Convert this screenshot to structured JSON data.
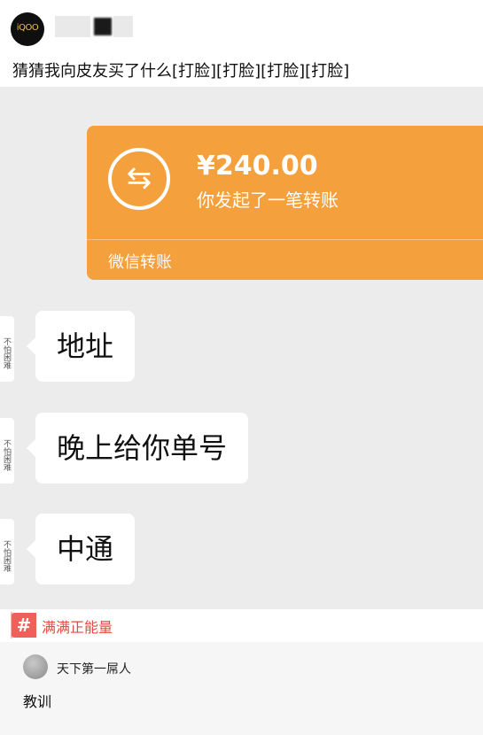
{
  "post": {
    "avatar_text": "iQOO",
    "text": "猜猜我向皮友买了什么[打脸][打脸][打脸][打脸]"
  },
  "transfer": {
    "icon": "transfer-arrows-icon",
    "icon_glyph": "⇆",
    "amount": "¥240.00",
    "description": "你发起了一笔转账",
    "footer": "微信转账",
    "color": "#f4a03c"
  },
  "messages": [
    {
      "avatar_text": "不怕困难",
      "text": "地址"
    },
    {
      "avatar_text": "不怕困难",
      "text": "晚上给你单号"
    },
    {
      "avatar_text": "不怕困难",
      "text": "中通"
    }
  ],
  "hashtag": {
    "icon_glyph": "#",
    "label": "满满正能量"
  },
  "comment": {
    "user": "天下第一屌人",
    "text": "教训"
  }
}
